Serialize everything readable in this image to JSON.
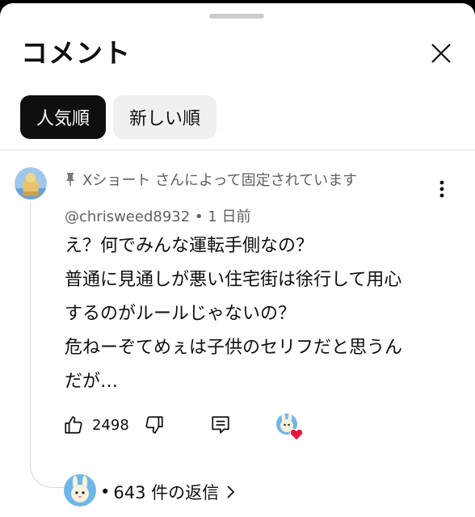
{
  "header": {
    "title": "コメント"
  },
  "sort_chips": [
    {
      "label": "人気順",
      "active": true
    },
    {
      "label": "新しい順",
      "active": false
    }
  ],
  "comment": {
    "pinned_text": "Xショート さんによって固定されています",
    "author": "@chrisweed8932",
    "time": "1 日前",
    "lines": [
      "え？何でみんな運転手側なの？",
      "普通に見通しが悪い住宅街は徐行して用心",
      "するのがルールじゃないの？",
      "危ねーぞてめぇは子供のセリフだと思うん",
      "だが…"
    ],
    "like_count": "2498",
    "replies_label": "643 件の返信"
  },
  "icons": {
    "pin": "pin-icon",
    "more": "more-vert-icon",
    "close": "close-icon",
    "like": "thumb-up-icon",
    "dislike": "thumb-down-icon",
    "reply": "reply-icon",
    "creator_heart": "creator-heart-icon",
    "chevron": "chevron-right-icon"
  },
  "colors": {
    "active_chip": "#0f0f0f",
    "chip": "#f0f0f0",
    "secondary_text": "#606060",
    "heart": "#e8173c"
  }
}
